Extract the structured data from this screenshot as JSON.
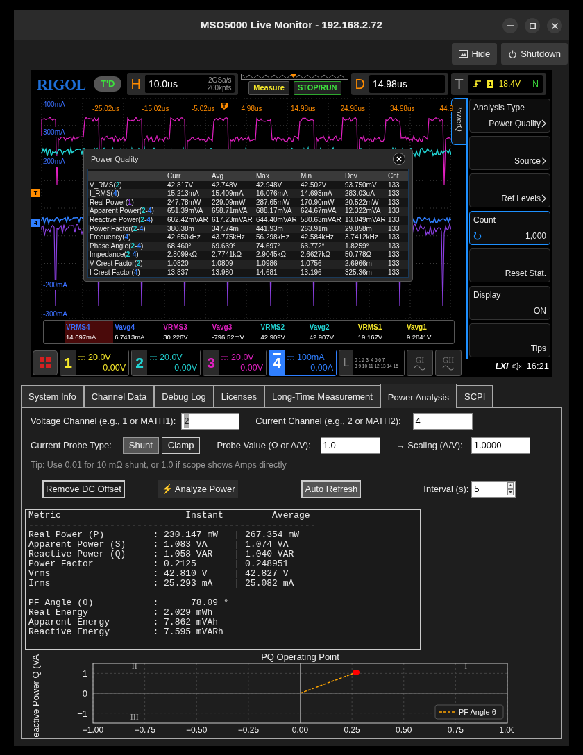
{
  "window": {
    "title": "MSO5000 Live Monitor - 192.168.2.72"
  },
  "toolbar": [
    {
      "label": "Hide"
    },
    {
      "label": "Shutdown"
    }
  ],
  "scope": {
    "brand": "RIGOL",
    "run_status": "T'D",
    "horizontal": {
      "letter": "H",
      "timebase": "10.0us",
      "sample_rate": "2GSa/s",
      "memory_depth": "200kpts"
    },
    "measure_button": "Measure",
    "run_button": "STOP/RUN",
    "delay": {
      "letter": "D",
      "value": "14.98us"
    },
    "trigger": {
      "letter": "T",
      "source": "1",
      "level": "18.4V",
      "mode": "N"
    },
    "time_labels": [
      "-25.02us",
      "-15.02us",
      "-5.02us",
      "4.98us",
      "14.98us",
      "24.98us",
      "34.98us",
      "44.9"
    ],
    "scale_labels": [
      "400mA",
      "300mA",
      "200mA",
      "-200mA",
      "-300mA"
    ],
    "level_markers": [
      {
        "label": "T",
        "color": "#ff8c00"
      },
      {
        "label": "4",
        "color": "#2f7fff"
      }
    ],
    "dialog": {
      "title": "Power Quality",
      "columns": [
        "Curr",
        "Avg",
        "Max",
        "Min",
        "Dev",
        "Cnt"
      ],
      "rows": [
        {
          "name": [
            {
              "text": "V_RMS("
            },
            {
              "text": "2",
              "color": "#22d3d3"
            },
            {
              "text": ")"
            }
          ],
          "values": [
            "42.817V",
            "42.748V",
            "42.948V",
            "42.502V",
            "93.750mV",
            "133"
          ]
        },
        {
          "name": [
            {
              "text": "I_RMS("
            },
            {
              "text": "4",
              "color": "#2f7fff"
            },
            {
              "text": ")"
            }
          ],
          "values": [
            "15.213mA",
            "15.409mA",
            "16.076mA",
            "14.693mA",
            "283.03uA",
            "133"
          ]
        },
        {
          "name": [
            {
              "text": "Real Power("
            },
            {
              "text": "1",
              "color": "#8b3fe0"
            },
            {
              "text": ")"
            }
          ],
          "values": [
            "247.78mW",
            "229.09mW",
            "287.65mW",
            "170.90mW",
            "20.522mW",
            "133"
          ]
        },
        {
          "name": [
            {
              "text": "Apparent Power("
            },
            {
              "text": "2",
              "color": "#22d3d3"
            },
            {
              "text": "-"
            },
            {
              "text": "4",
              "color": "#2f7fff"
            },
            {
              "text": ")"
            }
          ],
          "values": [
            "651.39mVA",
            "658.71mVA",
            "688.17mVA",
            "624.67mVA",
            "12.322mVA",
            "133"
          ]
        },
        {
          "name": [
            {
              "text": "Reactive Power("
            },
            {
              "text": "2",
              "color": "#22d3d3"
            },
            {
              "text": "-"
            },
            {
              "text": "4",
              "color": "#2f7fff"
            },
            {
              "text": ")"
            }
          ],
          "values": [
            "602.42mVAR",
            "617.23mVAR",
            "644.40mVAR",
            "580.63mVAR",
            "13.049mVAR",
            "133"
          ]
        },
        {
          "name": [
            {
              "text": "Power Factor("
            },
            {
              "text": "2",
              "color": "#22d3d3"
            },
            {
              "text": "-"
            },
            {
              "text": "4",
              "color": "#2f7fff"
            },
            {
              "text": ")"
            }
          ],
          "values": [
            "380.38m",
            "347.74m",
            "441.93m",
            "263.91m",
            "29.858m",
            "133"
          ]
        },
        {
          "name": [
            {
              "text": "Frequency("
            },
            {
              "text": "4",
              "color": "#2f7fff"
            },
            {
              "text": ")"
            }
          ],
          "values": [
            "42.650kHz",
            "43.775kHz",
            "56.298kHz",
            "42.584kHz",
            "3.7412kHz",
            "133"
          ]
        },
        {
          "name": [
            {
              "text": "Phase Angle("
            },
            {
              "text": "2",
              "color": "#22d3d3"
            },
            {
              "text": "-"
            },
            {
              "text": "4",
              "color": "#2f7fff"
            },
            {
              "text": ")"
            }
          ],
          "values": [
            "68.460°",
            "69.639°",
            "74.697°",
            "63.772°",
            "1.8259°",
            "133"
          ]
        },
        {
          "name": [
            {
              "text": "Impedance("
            },
            {
              "text": "2",
              "color": "#22d3d3"
            },
            {
              "text": "-"
            },
            {
              "text": "4",
              "color": "#2f7fff"
            },
            {
              "text": ")"
            }
          ],
          "values": [
            "2.8099kΩ",
            "2.7741kΩ",
            "2.9045kΩ",
            "2.6627kΩ",
            "50.778Ω",
            "133"
          ]
        },
        {
          "name": [
            {
              "text": "V Crest Factor("
            },
            {
              "text": "2",
              "color": "#22d3d3"
            },
            {
              "text": ")"
            }
          ],
          "values": [
            "1.0820",
            "1.0809",
            "1.0986",
            "1.0756",
            "2.6966m",
            "133"
          ]
        },
        {
          "name": [
            {
              "text": "I Crest Factor("
            },
            {
              "text": "4",
              "color": "#2f7fff"
            },
            {
              "text": ")"
            }
          ],
          "values": [
            "13.837",
            "13.980",
            "14.681",
            "13.196",
            "325.36m",
            "133"
          ]
        }
      ]
    },
    "measurements": [
      {
        "label": "VRMS4",
        "value": "14.697mA",
        "color": "#3a6fff",
        "selected": true
      },
      {
        "label": "Vavg4",
        "value": "6.7413mA",
        "color": "#3a6fff",
        "selected": false
      },
      {
        "label": "VRMS3",
        "value": "30.226V",
        "color": "#e020c0",
        "selected": false
      },
      {
        "label": "Vavg3",
        "value": "-796.52mV",
        "color": "#e020c0",
        "selected": false
      },
      {
        "label": "VRMS2",
        "value": "42.909V",
        "color": "#22d3d3",
        "selected": false
      },
      {
        "label": "Vavg2",
        "value": "42.907V",
        "color": "#22d3d3",
        "selected": false
      },
      {
        "label": "VRMS1",
        "value": "19.167V",
        "color": "#f5e72a",
        "selected": false
      },
      {
        "label": "Vavg1",
        "value": "9.2841V",
        "color": "#f5e72a",
        "selected": false
      }
    ],
    "channels": [
      {
        "number": "1",
        "scale": "20.0V",
        "offset": "0.00V",
        "color": "#f5e72a",
        "active": false
      },
      {
        "number": "2",
        "scale": "20.0V",
        "offset": "0.00V",
        "color": "#22d3d3",
        "active": false
      },
      {
        "number": "3",
        "scale": "20.0V",
        "offset": "0.00V",
        "color": "#e020c0",
        "active": false
      },
      {
        "number": "4",
        "scale": "100mA",
        "offset": "0.00A",
        "color": "#2f7fff",
        "active": true
      }
    ],
    "logic": {
      "letter": "L",
      "row_1": "0 1 2 3  4 5 6 7",
      "row_2": "8 9 10 11 12 13 14 15"
    },
    "generators": [
      "GI",
      "GII"
    ],
    "status": {
      "lxi": "LXI",
      "time": "16:21"
    },
    "menu": {
      "tab": "PowerQ",
      "items": [
        {
          "title": "Analysis Type",
          "value": "Power Quality",
          "kind": "submenu",
          "selected": false
        },
        {
          "value": "Source",
          "kind": "submenu",
          "selected": false
        },
        {
          "value": "Ref Levels",
          "kind": "submenu",
          "selected": false
        },
        {
          "title": "Count",
          "value": "1,000",
          "kind": "knob",
          "selected": true
        },
        {
          "value": "Reset Stat.",
          "kind": "action",
          "selected": false
        },
        {
          "title": "Display",
          "value": "ON",
          "kind": "option",
          "selected": false
        },
        {
          "value": "Tips",
          "kind": "action",
          "selected": false
        }
      ]
    }
  },
  "tabs": [
    {
      "label": "System Info",
      "selected": false
    },
    {
      "label": "Channel Data",
      "selected": false
    },
    {
      "label": "Debug Log",
      "selected": false
    },
    {
      "label": "Licenses",
      "selected": false
    },
    {
      "label": "Long-Time Measurement",
      "selected": false
    },
    {
      "label": "Power Analysis",
      "selected": true
    },
    {
      "label": "SCPI",
      "selected": false
    }
  ],
  "power_analysis": {
    "voltage_channel": {
      "label": "Voltage Channel (e.g., 1 or MATH1):",
      "value": "2",
      "text_selected": true
    },
    "current_channel": {
      "label": "Current Channel (e.g., 2 or MATH2):",
      "value": "4",
      "text_selected": false
    },
    "probe_type": {
      "label": "Current Probe Type:",
      "options": [
        {
          "label": "Shunt",
          "selected": true
        },
        {
          "label": "Clamp",
          "selected": false
        }
      ]
    },
    "probe_value": {
      "label": "Probe Value (Ω or A/V):",
      "value": "1.0"
    },
    "scaling": {
      "label": "→ Scaling (A/V):",
      "value": "1.0000"
    },
    "tip": "Tip: Use 0.01 for 10 mΩ shunt, or 1.0 if scope shows Amps directly",
    "actions": [
      {
        "label": "Remove DC Offset",
        "kind": "outlined"
      },
      {
        "label": "⚡ Analyze Power",
        "kind": "flat"
      },
      {
        "label": "Auto Refresh",
        "kind": "raised"
      }
    ],
    "interval": {
      "label": "Interval (s):",
      "value": "5"
    }
  },
  "output": {
    "header": "Metric                       Instant         Average",
    "rule": "-----------------------------------------------------",
    "power_lines": [
      "Real Power (P)         : 230.147 mW   | 267.354 mW",
      "Apparent Power (S)     : 1.083 VA     | 1.074 VA",
      "Reactive Power (Q)     : 1.058 VAR    | 1.040 VAR",
      "Power Factor           : 0.2125       | 0.248951",
      "Vrms                   : 42.810 V     | 42.827 V",
      "Irms                   : 25.293 mA    | 25.082 mA"
    ],
    "energy_lines": [
      "PF Angle (θ)           :      78.09 °",
      "Real Energy            : 2.029 mWh",
      "Apparent Energy        : 7.862 mVAh",
      "Reactive Energy        : 7.595 mVARh"
    ]
  },
  "chart_data": {
    "type": "line",
    "title": "PQ Operating Point",
    "ylabel": "eactive Power Q (VA",
    "xlim": [
      -1,
      1
    ],
    "ylim": [
      -1.5,
      1.5
    ],
    "xticks": [
      {
        "value": -1,
        "label": "−1.00"
      },
      {
        "value": -0.75,
        "label": "−0.75"
      },
      {
        "value": -0.5,
        "label": "−0.50"
      },
      {
        "value": -0.25,
        "label": "−0.25"
      },
      {
        "value": 0,
        "label": "0.00"
      },
      {
        "value": 0.25,
        "label": "0.25"
      },
      {
        "value": 0.5,
        "label": "0.50"
      },
      {
        "value": 0.75,
        "label": "0.75"
      },
      {
        "value": 1,
        "label": "1.00"
      }
    ],
    "yticks": [
      {
        "value": -1,
        "label": "−1"
      },
      {
        "value": 0,
        "label": "0"
      },
      {
        "value": 1,
        "label": "1"
      }
    ],
    "x": [
      0,
      0.27
    ],
    "grid": true,
    "series": [
      {
        "name": "PF Angle θ",
        "color": "#ffa500",
        "line_style": "dashed",
        "values": [
          0,
          1.05
        ]
      }
    ],
    "annotations": [
      "II",
      "I",
      "III"
    ]
  }
}
